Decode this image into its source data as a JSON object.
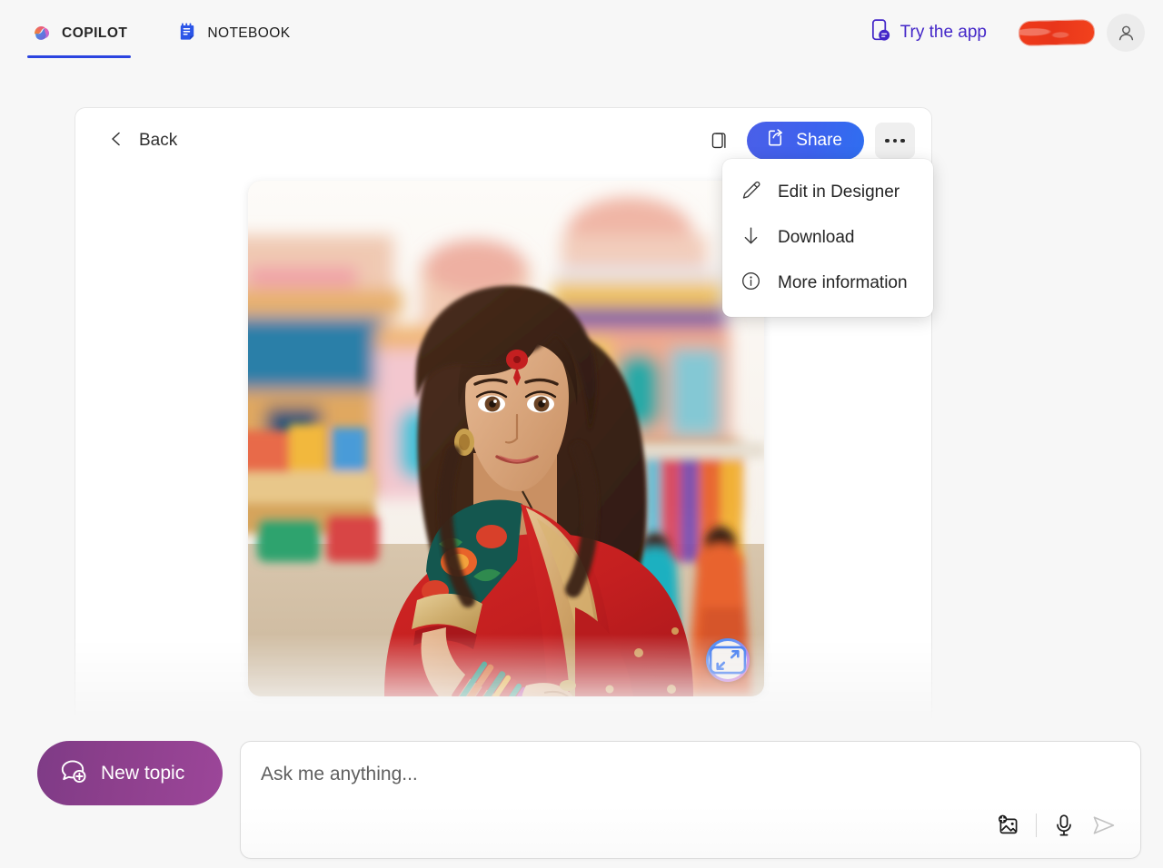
{
  "header": {
    "tabs": [
      {
        "label": "COPILOT",
        "icon": "copilot-icon",
        "active": true
      },
      {
        "label": "NOTEBOOK",
        "icon": "notebook-icon",
        "active": false
      }
    ],
    "try_app_label": "Try the app",
    "try_app_icon": "phone-chat-icon",
    "redaction_note": "",
    "avatar_icon": "person-icon"
  },
  "card": {
    "back_label": "Back",
    "back_icon": "chevron-left-icon",
    "copy_icon": "copy-icon",
    "share_label": "Share",
    "share_icon": "share-icon",
    "more_icon": "ellipsis-icon",
    "expand_icon": "expand-icon"
  },
  "menu": {
    "items": [
      {
        "label": "Edit in Designer",
        "icon": "pencil-icon"
      },
      {
        "label": "Download",
        "icon": "arrow-down-icon"
      },
      {
        "label": "More information",
        "icon": "info-circle-icon"
      }
    ]
  },
  "composer": {
    "new_topic_label": "New topic",
    "new_topic_icon": "chat-plus-icon",
    "placeholder": "Ask me anything...",
    "add_image_icon": "add-image-icon",
    "microphone_icon": "microphone-icon",
    "send_icon": "send-icon"
  },
  "colors": {
    "accent_blue": "#2b44e0",
    "share_blue": "#3d62ee",
    "purple": "#8c3f8c",
    "try_app_purple": "#4326c8",
    "redaction_red": "#ef3b1b",
    "page_bg": "#f7f7f7"
  }
}
